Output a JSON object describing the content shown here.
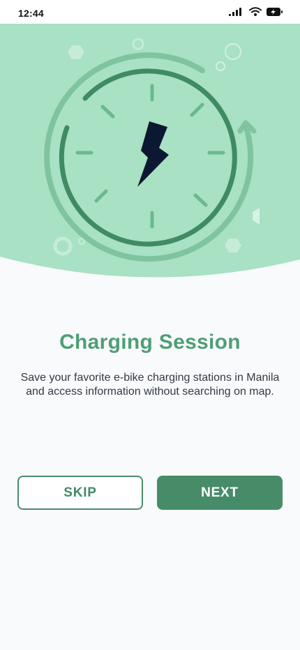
{
  "status_bar": {
    "time": "12:44",
    "icons": [
      "cellular-signal-icon",
      "wifi-icon",
      "battery-charging-icon"
    ]
  },
  "illustration": {
    "icons": [
      "charging-gauge-illustration",
      "lightning-bolt-icon"
    ]
  },
  "onboarding": {
    "title": "Charging Session",
    "description": "Save your favorite e-bike charging stations in Manila and access information without searching on map."
  },
  "actions": {
    "skip_label": "SKIP",
    "next_label": "NEXT"
  },
  "colors": {
    "hero_background": "#a8e1c3",
    "primary_green": "#468c69",
    "title_green": "#4f9e76",
    "bolt_navy": "#0c1731"
  }
}
